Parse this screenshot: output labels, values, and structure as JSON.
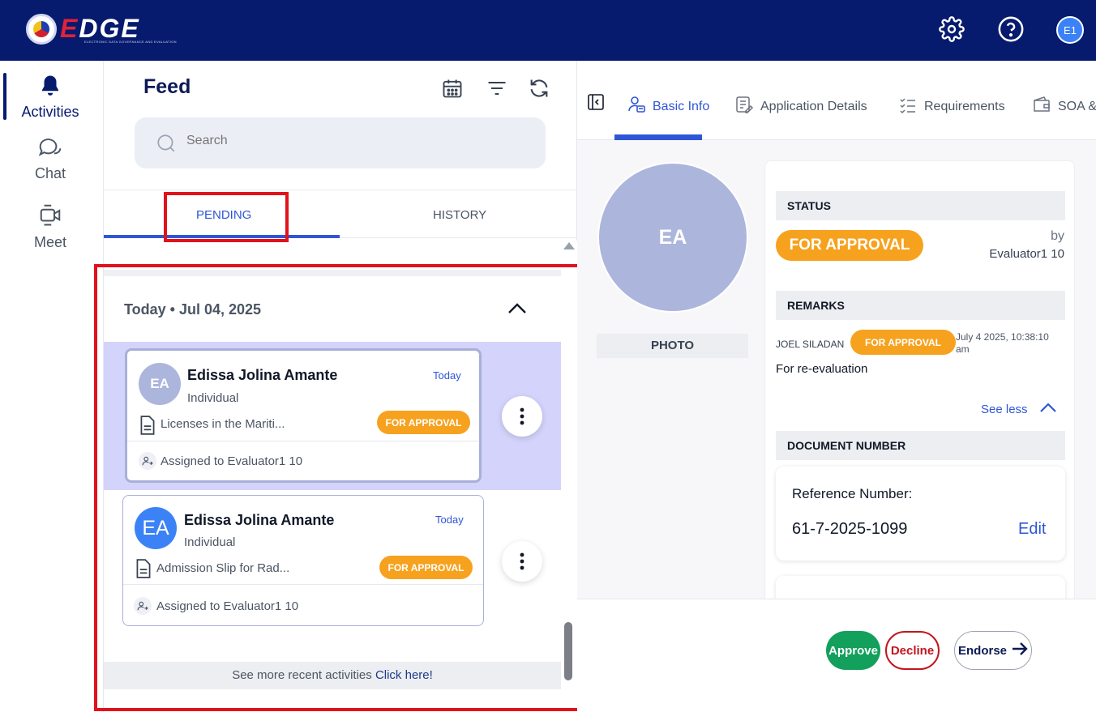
{
  "app": {
    "logo_text_accent": "E",
    "logo_text": "DGE",
    "logo_subtitle": "ELECTRONIC DATA GOVERNANCE AND EVALUATION",
    "user_initials": "E1"
  },
  "rail": {
    "items": [
      {
        "label": "Activities",
        "icon": "bell-icon",
        "active": true
      },
      {
        "label": "Chat",
        "icon": "chat-icon"
      },
      {
        "label": "Meet",
        "icon": "video-icon"
      }
    ]
  },
  "feed": {
    "title": "Feed",
    "search_placeholder": "Search",
    "tabs": [
      {
        "label": "PENDING",
        "active": true
      },
      {
        "label": "HISTORY"
      }
    ],
    "group_header": "Today • Jul 04, 2025",
    "cards": [
      {
        "initials": "EA",
        "name": "Edissa Jolina Amante",
        "type": "Individual",
        "date": "Today",
        "document": "Licenses in the Mariti...",
        "status": "FOR APPROVAL",
        "assigned": "Assigned to Evaluator1 10",
        "avatar_color": "#acb5dc",
        "selected": true
      },
      {
        "initials": "EA",
        "name": "Edissa Jolina Amante",
        "type": "Individual",
        "date": "Today",
        "document": "Admission Slip for Rad...",
        "status": "FOR APPROVAL",
        "assigned": "Assigned to Evaluator1 10",
        "avatar_color": "#3b82f6",
        "selected": false
      }
    ],
    "see_more_text": "See more recent activities",
    "see_more_link": "Click here!"
  },
  "detail": {
    "tabs": [
      {
        "label": "Basic Info",
        "active": true
      },
      {
        "label": "Application Details"
      },
      {
        "label": "Requirements"
      },
      {
        "label": "SOA &"
      }
    ],
    "photo_initials": "EA",
    "photo_label": "PHOTO",
    "status_heading": "STATUS",
    "status_value": "FOR APPROVAL",
    "status_by": "by",
    "status_by_name": "Evaluator1 10",
    "remarks_heading": "REMARKS",
    "remark": {
      "author": "JOEL SILADAN",
      "status": "FOR APPROVAL",
      "date": "July 4 2025, 10:38:10 am",
      "text": "For re-evaluation"
    },
    "see_less": "See less",
    "document_heading": "DOCUMENT NUMBER",
    "reference_label": "Reference Number:",
    "reference_value": "61-7-2025-1099",
    "edit_label": "Edit"
  },
  "actions": {
    "approve": "Approve",
    "decline": "Decline",
    "endorse": "Endorse"
  },
  "colors": {
    "topbar": "#061a6e",
    "accent": "#2f56d6",
    "badge": "#f6a21e",
    "approve": "#12a05c",
    "decline": "#c3161c",
    "highlight": "#e0121b"
  }
}
